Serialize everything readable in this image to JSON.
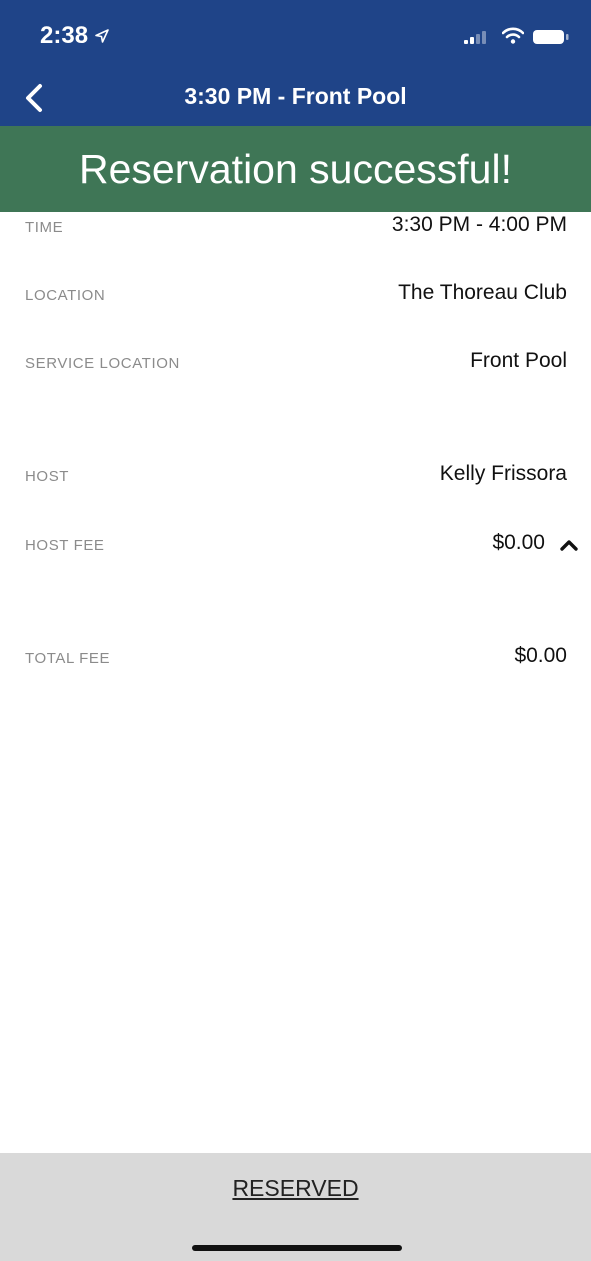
{
  "status_bar": {
    "time": "2:38",
    "icons": [
      "location-arrow-icon",
      "cellular-signal-icon",
      "wifi-icon",
      "battery-icon"
    ]
  },
  "nav": {
    "title": "3:30 PM - Front Pool",
    "back_icon": "chevron-left-icon"
  },
  "banner": {
    "text": "Reservation successful!"
  },
  "details": {
    "time": {
      "label": "TIME",
      "value": "3:30 PM - 4:00 PM"
    },
    "location": {
      "label": "LOCATION",
      "value": "The Thoreau Club"
    },
    "service_location": {
      "label": "SERVICE LOCATION",
      "value": "Front Pool"
    },
    "host": {
      "label": "HOST",
      "value": "Kelly Frissora"
    },
    "host_fee": {
      "label": "HOST FEE",
      "value": "$0.00",
      "toggle_icon": "chevron-up-icon"
    },
    "total_fee": {
      "label": "TOTAL FEE",
      "value": "$0.00"
    }
  },
  "footer": {
    "status_label": "RESERVED"
  },
  "colors": {
    "header_blue": "#1f4488",
    "success_green": "#3f7656",
    "footer_gray": "#d9d9d9",
    "label_gray": "#8b8b8b"
  }
}
